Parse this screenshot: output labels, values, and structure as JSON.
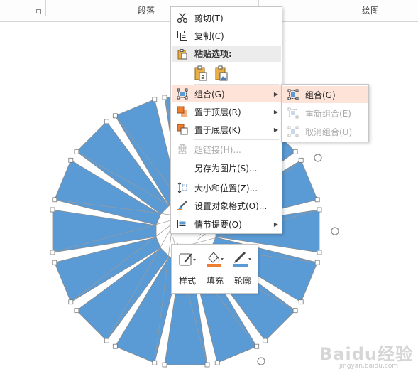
{
  "ribbon": {
    "group_paragraph": "段落",
    "group_drawing": "绘图"
  },
  "colors": {
    "shape_fill": "#5b9bd5",
    "menu_highlight": "#fde3d8",
    "fill_accent": "#ed7d31",
    "outline_accent": "#5b9bd5"
  },
  "context_menu": {
    "items": [
      {
        "label": "剪切(T)",
        "icon": "scissors-icon",
        "enabled": true
      },
      {
        "label": "复制(C)",
        "icon": "copy-icon",
        "enabled": true
      },
      {
        "label": "粘贴选项:",
        "icon": "paste-icon",
        "enabled": true
      },
      {
        "label": "组合(G)",
        "icon": "group-icon",
        "enabled": true,
        "submenu": true,
        "highlighted": true
      },
      {
        "label": "置于顶层(R)",
        "icon": "bring-to-front-icon",
        "enabled": true,
        "submenu": true
      },
      {
        "label": "置于底层(K)",
        "icon": "send-to-back-icon",
        "enabled": true,
        "submenu": true
      },
      {
        "label": "超链接(H)...",
        "icon": "hyperlink-icon",
        "enabled": false
      },
      {
        "label": "另存为图片(S)...",
        "icon": "",
        "enabled": true
      },
      {
        "label": "大小和位置(Z)...",
        "icon": "size-position-icon",
        "enabled": true
      },
      {
        "label": "设置对象格式(O)...",
        "icon": "format-object-icon",
        "enabled": true
      },
      {
        "label": "情节提要(O)",
        "icon": "storyboard-icon",
        "enabled": true,
        "submenu": true
      }
    ],
    "paste_options": [
      "keep-text-only-icon",
      "paste-as-picture-icon"
    ]
  },
  "group_submenu": {
    "items": [
      {
        "label": "组合(G)",
        "icon": "group-icon",
        "enabled": true,
        "highlighted": true
      },
      {
        "label": "重新组合(E)",
        "icon": "regroup-icon",
        "enabled": false
      },
      {
        "label": "取消组合(U)",
        "icon": "ungroup-icon",
        "enabled": false
      }
    ]
  },
  "mini_toolbar": {
    "style": "样式",
    "fill": "填充",
    "outline": "轮廓"
  },
  "watermark": {
    "brand": "Baidu经验",
    "url": "jingyan.baidu.com"
  }
}
